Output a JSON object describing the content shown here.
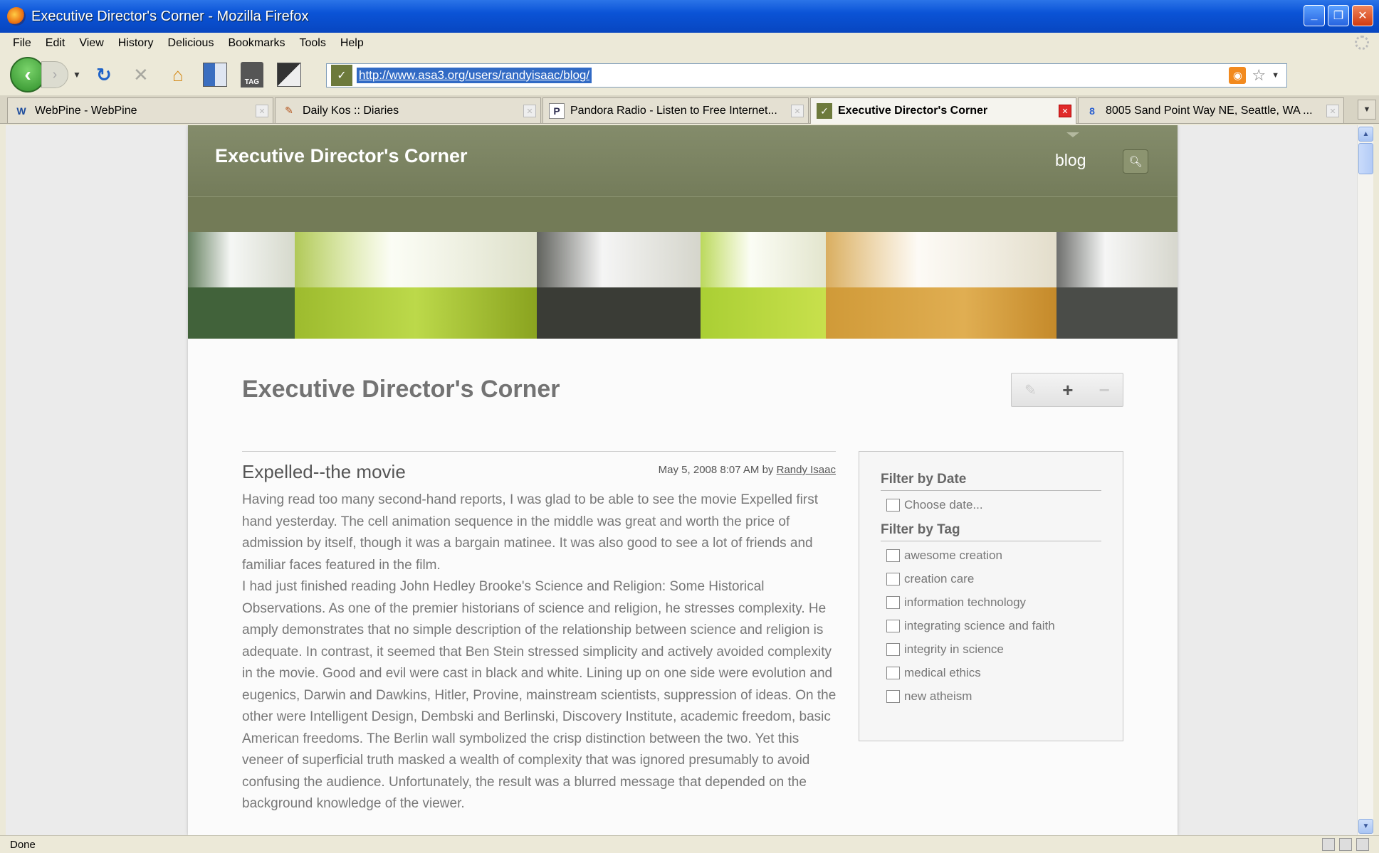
{
  "window": {
    "title": "Executive Director's Corner - Mozilla Firefox"
  },
  "menu": [
    "File",
    "Edit",
    "View",
    "History",
    "Delicious",
    "Bookmarks",
    "Tools",
    "Help"
  ],
  "toolbar": {
    "url": "http://www.asa3.org/users/randyisaac/blog/",
    "tag_label": "TAG"
  },
  "tabs": [
    {
      "label": "WebPine - WebPine",
      "icon": "W",
      "active": false
    },
    {
      "label": "Daily Kos :: Diaries",
      "icon": "✎",
      "active": false
    },
    {
      "label": "Pandora Radio - Listen to Free Internet...",
      "icon": "P",
      "active": false
    },
    {
      "label": "Executive Director's Corner",
      "icon": "✓",
      "active": true
    },
    {
      "label": "8005 Sand Point Way NE, Seattle, WA ...",
      "icon": "8",
      "active": false
    }
  ],
  "site": {
    "title": "Executive Director's Corner",
    "nav_blog": "blog",
    "search_icon": "search-icon"
  },
  "page": {
    "title": "Executive Director's Corner"
  },
  "post": {
    "title": "Expelled--the movie",
    "date": "May 5, 2008 8:07 AM by ",
    "author": "Randy Isaac",
    "paragraphs": [
      "Having read too many second-hand reports, I was glad to be able to see the movie Expelled first hand yesterday. The cell animation sequence in the middle was great and worth the price of admission by itself, though it was a bargain matinee. It was also good to see a lot of friends and familiar faces featured in the film.",
      "I had just finished reading John Hedley Brooke's Science and Religion: Some Historical Observations. As one of the premier historians of science and religion, he stresses complexity. He amply demonstrates that no simple description of the relationship between science and religion is adequate. In contrast, it seemed that Ben Stein stressed simplicity and actively avoided complexity in the movie. Good and evil were cast in black and white. Lining up on one side were evolution and eugenics, Darwin and Dawkins, Hitler, Provine, mainstream scientists, suppression of ideas. On the other were Intelligent Design, Dembski and Berlinski, Discovery Institute, academic freedom, basic American freedoms. The Berlin wall symbolized the crisp distinction between the two. Yet this veneer of superficial truth masked a wealth of complexity that was ignored presumably to avoid confusing the audience. Unfortunately, the result was a blurred message that depended on the background knowledge of the viewer."
    ]
  },
  "sidebar": {
    "date_heading": "Filter by Date",
    "date_option": "Choose date...",
    "tag_heading": "Filter by Tag",
    "tags": [
      "awesome creation",
      "creation care",
      "information technology",
      "integrating science and faith",
      "integrity in science",
      "medical ethics",
      "new atheism"
    ]
  },
  "status": {
    "text": "Done"
  },
  "colors": {
    "header": "#737b57",
    "titlebar": "#0a53d6",
    "accent_url": "#316ac5"
  }
}
